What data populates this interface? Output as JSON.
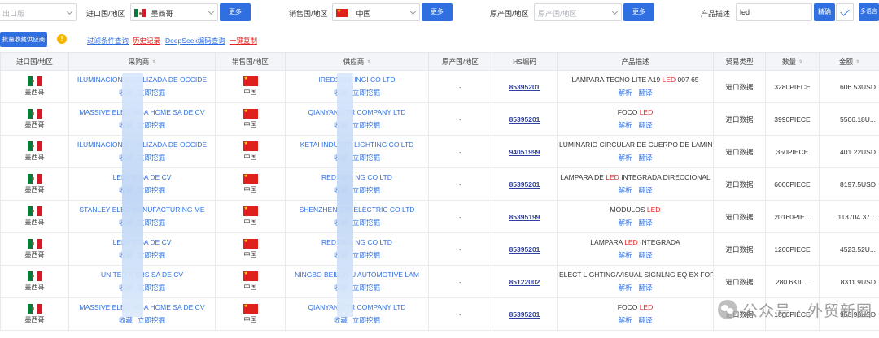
{
  "filters": {
    "first_field": {
      "value": "出口版",
      "is_placeholder": true
    },
    "importer_country_label": "进口国/地区",
    "importer_country_value": "墨西哥",
    "more_label": "更多",
    "seller_country_label": "销售国/地区",
    "seller_country_value": "中国",
    "origin_country_label": "原产国/地区",
    "origin_country_placeholder": "原产国/地区",
    "product_desc_label": "产品描述",
    "product_desc_value": "led",
    "exact_label": "精确",
    "multi_search_label": "多语言"
  },
  "toolbar": {
    "bulk_favorite_label": "批量收藏供应商",
    "info_icon_text": "!",
    "links": [
      {
        "label": "过滤条件查询",
        "color": "#2f6fe0"
      },
      {
        "label": "历史记录",
        "color": "#e02424"
      },
      {
        "label": "DeepSeek编码查询",
        "color": "#2f6fe0"
      },
      {
        "label": "一键复制",
        "color": "#e02424"
      }
    ]
  },
  "table": {
    "columns": [
      "进口国/地区",
      "采购商",
      "销售国/地区",
      "供应商",
      "原产国/地区",
      "HS编码",
      "产品描述",
      "贸易类型",
      "数量",
      "金额"
    ],
    "sort_glyph": "⇕",
    "rows": [
      {
        "importer_country": "墨西哥",
        "buyer": "ILUMINACION E     CIALIZADA DE OCCIDE",
        "buyer_actions": [
          "收藏",
          "立即挖掘"
        ],
        "seller_country": "中国",
        "supplier": "IRED100 L     INGI CO LTD",
        "supplier_actions": [
          "收藏",
          "立即挖掘"
        ],
        "origin": "-",
        "hs_code": "85395201",
        "desc_before": "LAMPARA TECNO LITE A19 ",
        "desc_hl": "LED",
        "desc_after": " 007 65",
        "desc_actions": [
          "解析",
          "翻译"
        ],
        "trade_type": "进口数据",
        "quantity": "3280PIECE",
        "amount": "606.53USD"
      },
      {
        "importer_country": "墨西哥",
        "buyer": "MASSIVE ELEC     NICA HOME SA DE CV",
        "buyer_actions": [
          "收藏",
          "立即挖掘"
        ],
        "seller_country": "中国",
        "supplier": "QIANYANG TR     COMPANY LTD",
        "supplier_actions": [
          "收藏",
          "立即挖掘"
        ],
        "origin": "-",
        "hs_code": "85395201",
        "desc_before": "FOCO ",
        "desc_hl": "LED",
        "desc_after": "",
        "desc_actions": [
          "解析",
          "翻译"
        ],
        "trade_type": "进口数据",
        "quantity": "3990PIECE",
        "amount": "5506.18U..."
      },
      {
        "importer_country": "墨西哥",
        "buyer": "ILUMINACION E     CIALIZADA DE OCCIDE",
        "buyer_actions": [
          "收藏",
          "立即挖掘"
        ],
        "seller_country": "中国",
        "supplier": "KETAI INDUSTR     LIGHTING CO LTD",
        "supplier_actions": [
          "收藏",
          "立即挖掘"
        ],
        "origin": "-",
        "hs_code": "94051999",
        "desc_before": "LUMINARIO CIRCULAR DE CUERPO DE LAMIN",
        "desc_hl": "",
        "desc_after": "",
        "desc_actions": [
          "解析",
          "翻译"
        ],
        "trade_type": "进口数据",
        "quantity": "350PIECE",
        "amount": "401.22USD"
      },
      {
        "importer_country": "墨西哥",
        "buyer": "LEDV     E SA DE CV",
        "buyer_actions": [
          "收藏",
          "立即挖掘"
        ],
        "seller_country": "中国",
        "supplier": "RED100 L     NG CO LTD",
        "supplier_actions": [
          "收藏",
          "立即挖掘"
        ],
        "origin": "-",
        "hs_code": "85395201",
        "desc_before": "LAMPARA DE ",
        "desc_hl": "LED",
        "desc_after": " INTEGRADA DIRECCIONAL",
        "desc_actions": [
          "解析",
          "翻译"
        ],
        "trade_type": "进口数据",
        "quantity": "6000PIECE",
        "amount": "8197.5USD"
      },
      {
        "importer_country": "墨西哥",
        "buyer": "STANLEY ELEC     MANUFACTURING ME",
        "buyer_actions": [
          "收藏",
          "立即挖掘"
        ],
        "seller_country": "中国",
        "supplier": "SHENZHEN STA     ELECTRIC CO LTD",
        "supplier_actions": [
          "收藏",
          "立即挖掘"
        ],
        "origin": "-",
        "hs_code": "85395199",
        "desc_before": "MODULOS ",
        "desc_hl": "LED",
        "desc_after": "",
        "desc_actions": [
          "解析",
          "翻译"
        ],
        "trade_type": "进口数据",
        "quantity": "20160PIE...",
        "amount": "113704.37..."
      },
      {
        "importer_country": "墨西哥",
        "buyer": "LEDV     E SA DE CV",
        "buyer_actions": [
          "收藏",
          "立即挖掘"
        ],
        "seller_country": "中国",
        "supplier": "RED100 L     NG CO LTD",
        "supplier_actions": [
          "收藏",
          "立即挖掘"
        ],
        "origin": "-",
        "hs_code": "85395201",
        "desc_before": "LAMPARA ",
        "desc_hl": "LED",
        "desc_after": " INTEGRADA",
        "desc_actions": [
          "解析",
          "翻译"
        ],
        "trade_type": "进口数据",
        "quantity": "1200PIECE",
        "amount": "4523.52U..."
      },
      {
        "importer_country": "墨西哥",
        "buyer": "UNITED E     ERS SA DE CV",
        "buyer_actions": [
          "收藏",
          "立即挖掘"
        ],
        "seller_country": "中国",
        "supplier": "NINGBO BEILUN     U AUTOMOTIVE LAM",
        "supplier_actions": [
          "收藏",
          "立即挖掘"
        ],
        "origin": "-",
        "hs_code": "85122002",
        "desc_before": "ELECT LIGHTING/VISUAL SIGNLNG EQ EX FOR",
        "desc_hl": "",
        "desc_after": "",
        "desc_actions": [
          "解析",
          "翻译"
        ],
        "trade_type": "进口数据",
        "quantity": "280.6KIL...",
        "amount": "8311.9USD"
      },
      {
        "importer_country": "墨西哥",
        "buyer": "MASSIVE ELEC     NICA HOME SA DE CV",
        "buyer_actions": [
          "收藏",
          "立即挖掘"
        ],
        "seller_country": "中国",
        "supplier": "QIANYANG TR     COMPANY LTD",
        "supplier_actions": [
          "收藏",
          "立即挖掘"
        ],
        "origin": "-",
        "hs_code": "85395201",
        "desc_before": "FOCO ",
        "desc_hl": "LED",
        "desc_after": "",
        "desc_actions": [
          "解析",
          "翻译"
        ],
        "trade_type": "进口数据",
        "quantity": "1800PIECE",
        "amount": "953.98USD"
      }
    ]
  },
  "watermark": {
    "text": "公众号 · 外贸新圈"
  },
  "colors": {
    "accent": "#2f6fe0",
    "highlight": "#e02424",
    "header_bg": "#f3f5f8"
  }
}
